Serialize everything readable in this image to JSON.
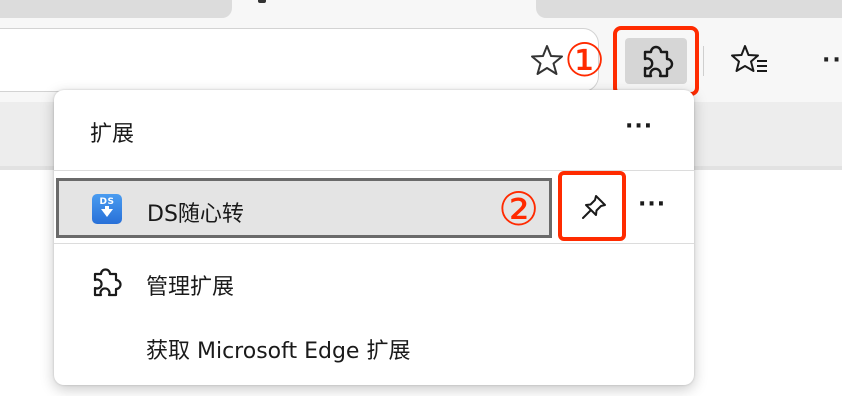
{
  "browser": {
    "annotation_1": "①",
    "toolbar_more": "···",
    "icons": {
      "favorite": "star-outline-icon",
      "extensions": "puzzle-piece-icon",
      "favorites_list": "star-list-icon"
    }
  },
  "popup": {
    "title": "扩展",
    "header_more": "···",
    "extensions": [
      {
        "name": "DS随心转",
        "icon_text": "DS",
        "icon_color": "#3a86e6",
        "annotation": "②",
        "pin_icon": "pin-icon",
        "more": "···"
      }
    ],
    "manage_label": "管理扩展",
    "get_label": "获取 Microsoft Edge 扩展"
  },
  "colors": {
    "highlight": "#ff2b00",
    "selected_row_bg": "#e4e4e4",
    "selected_row_border": "#6a6a6a"
  }
}
